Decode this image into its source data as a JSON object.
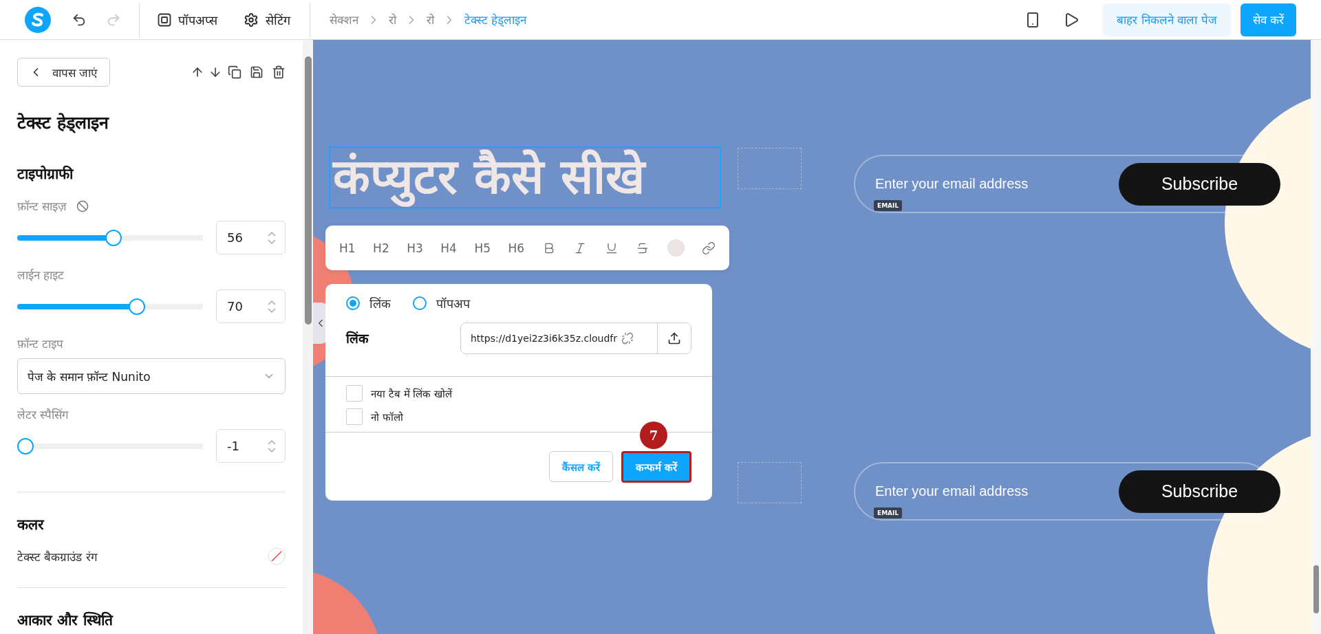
{
  "top_bar": {
    "history": [
      {
        "kind": "undo",
        "disabled": false
      },
      {
        "kind": "redo",
        "disabled": true
      }
    ],
    "menu": [
      {
        "kind": "popups",
        "label": "पॉपअप्स"
      },
      {
        "kind": "settings",
        "label": "सेटिंग"
      }
    ],
    "breadcrumb": [
      {
        "label": "सेक्शन",
        "selected": false
      },
      {
        "label": "रो",
        "selected": false
      },
      {
        "label": "रो",
        "selected": false
      },
      {
        "label": "टेक्स्ट हेड्लाइन",
        "selected": true
      }
    ],
    "exit_button": "बाहर निकलने वाला पेज",
    "save_button": "सेव करें"
  },
  "panel": {
    "back_button": "वापस जाएं",
    "title": "टेक्स्ट हेड्लाइन",
    "typography": {
      "heading": "टाइपोग्राफी",
      "controls": [
        {
          "kind": "slider",
          "label": "फ़ॉन्ट साइज़",
          "reset": true,
          "level": 0.52,
          "value": "56"
        },
        {
          "kind": "slider",
          "label": "लाईन हाइट",
          "reset": false,
          "level": 0.66,
          "value": "70"
        },
        {
          "kind": "select",
          "label": "फ़ॉन्ट टाइप",
          "value": "पेज के समान फ़ॉन्ट Nunito"
        },
        {
          "kind": "slider",
          "label": "लेटर स्पैसिंग",
          "reset": false,
          "level": 0,
          "value": "-1"
        }
      ]
    },
    "color": {
      "heading": "कलर",
      "label": "टेक्स्ट बैकग्राउंड रंग"
    },
    "size": {
      "heading": "आकार और स्थिति"
    }
  },
  "canvas": {
    "headline": "कंप्युटर कैसे सीखे",
    "format_toolbar": [
      {
        "kind": "text",
        "label": "H1"
      },
      {
        "kind": "text",
        "label": "H2"
      },
      {
        "kind": "text",
        "label": "H3"
      },
      {
        "kind": "text",
        "label": "H4"
      },
      {
        "kind": "text",
        "label": "H5"
      },
      {
        "kind": "text",
        "label": "H6"
      },
      {
        "kind": "bold"
      },
      {
        "kind": "italic"
      },
      {
        "kind": "underline"
      },
      {
        "kind": "strike"
      },
      {
        "kind": "color",
        "color": "#ede5e5"
      },
      {
        "kind": "link"
      }
    ],
    "link_popup": {
      "options": [
        {
          "label": "लिंक",
          "selected": true
        },
        {
          "label": "पॉपअप",
          "selected": false
        }
      ],
      "field_label": "लिंक",
      "url": "https://d1yei2z3i6k35z.cloudfr",
      "checkboxes": [
        {
          "label": "नया टैब में लिंक खोलें",
          "checked": false
        },
        {
          "label": "नो फॉलो",
          "checked": false
        }
      ],
      "cancel_button": "कैंसल करें",
      "confirm_button": "कन्फर्म करें",
      "step_badge": "7"
    },
    "email_forms": [
      {
        "placeholder": "Enter your email address",
        "tag": "EMAIL",
        "button": "Subscribe"
      },
      {
        "placeholder": "Enter your email address",
        "tag": "EMAIL",
        "button": "Subscribe"
      }
    ]
  }
}
